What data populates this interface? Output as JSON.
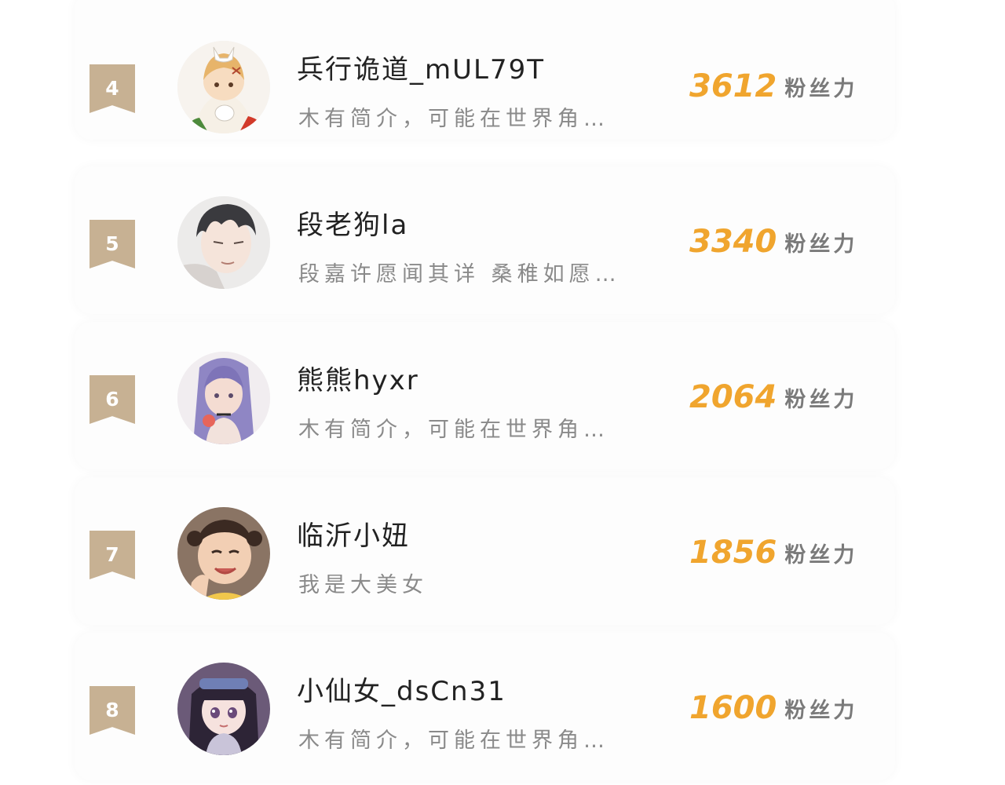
{
  "ranking": {
    "unit_label": "粉丝力",
    "badge_color": "#c7b193",
    "score_color": "#f0a52e",
    "items": [
      {
        "rank": "4",
        "name": "兵行诡道_mUL79T",
        "bio": "木有简介，可能在世界角…",
        "score": "3612",
        "avatar_icon": "avatar-anime-fox-mask"
      },
      {
        "rank": "5",
        "name": "段老狗la",
        "bio": "段嘉许愿闻其详  桑稚如愿…",
        "score": "3340",
        "avatar_icon": "avatar-anime-boy"
      },
      {
        "rank": "6",
        "name": "熊熊hyxr",
        "bio": "木有简介，可能在世界角…",
        "score": "2064",
        "avatar_icon": "avatar-anime-girl-purple-hair"
      },
      {
        "rank": "7",
        "name": "临沂小妞",
        "bio": "我是大美女",
        "score": "1856",
        "avatar_icon": "avatar-child-photo"
      },
      {
        "rank": "8",
        "name": "小仙女_dsCn31",
        "bio": "木有简介，可能在世界角…",
        "score": "1600",
        "avatar_icon": "avatar-anime-girl-dark-hair"
      }
    ]
  }
}
